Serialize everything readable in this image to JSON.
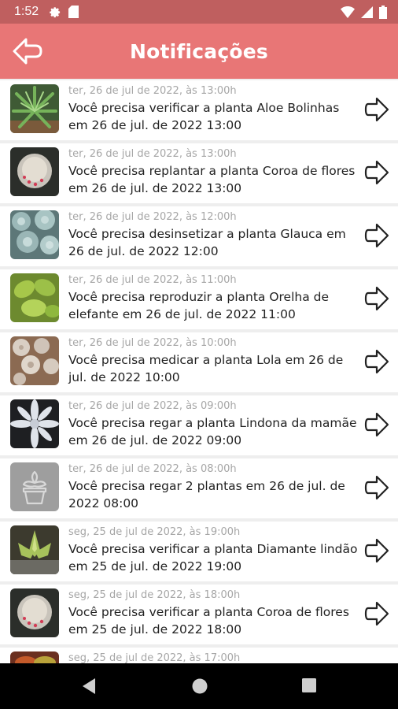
{
  "status": {
    "time": "1:52",
    "icons": [
      "gear-icon",
      "sd-card-icon",
      "wifi-icon",
      "signal-icon",
      "battery-icon"
    ],
    "color": "#bf5f5f"
  },
  "header": {
    "title": "Notificações",
    "back_icon": "arrow-left-icon",
    "color": "#e87676"
  },
  "notifications": [
    {
      "date": "ter, 26 de jul de 2022, às 13:00h",
      "message": "Você precisa verificar a planta Aloe Bolinhas em 26 de jul. de 2022 13:00",
      "image": "aloe"
    },
    {
      "date": "ter, 26 de jul de 2022, às 13:00h",
      "message": "Você precisa replantar a planta Coroa de flores em 26 de jul. de 2022 13:00",
      "image": "cactus"
    },
    {
      "date": "ter, 26 de jul de 2022, às 12:00h",
      "message": "Você precisa desinsetizar a planta Glauca em 26 de jul. de 2022 12:00",
      "image": "glauca"
    },
    {
      "date": "ter, 26 de jul de 2022, às 11:00h",
      "message": "Você precisa reproduzir a planta Orelha de elefante  em 26 de jul. de 2022 11:00",
      "image": "elephant-ear"
    },
    {
      "date": "ter, 26 de jul de 2022, às 10:00h",
      "message": "Você precisa medicar a planta Lola em 26 de jul. de 2022 10:00",
      "image": "lola"
    },
    {
      "date": "ter, 26 de jul de 2022, às 09:00h",
      "message": "Você precisa regar a planta Lindona da mamãe em 26 de jul. de 2022 09:00",
      "image": "lindona"
    },
    {
      "date": "ter, 26 de jul de 2022, às 08:00h",
      "message": "Você precisa regar 2 plantas em 26 de jul. de 2022 08:00",
      "image": "placeholder"
    },
    {
      "date": "seg, 25 de jul de 2022, às 19:00h",
      "message": "Você precisa verificar a planta Diamante lindão em 25 de jul. de 2022 19:00",
      "image": "diamante"
    },
    {
      "date": "seg, 25 de jul de 2022, às 18:00h",
      "message": "Você precisa verificar a planta Coroa de flores em 25 de jul. de 2022 18:00",
      "image": "cactus"
    },
    {
      "date": "seg, 25 de jul de 2022, às 17:00h",
      "message": "",
      "image": "red-succulent"
    }
  ],
  "nav": {
    "icons": [
      "nav-back-icon",
      "nav-home-icon",
      "nav-recents-icon"
    ]
  }
}
